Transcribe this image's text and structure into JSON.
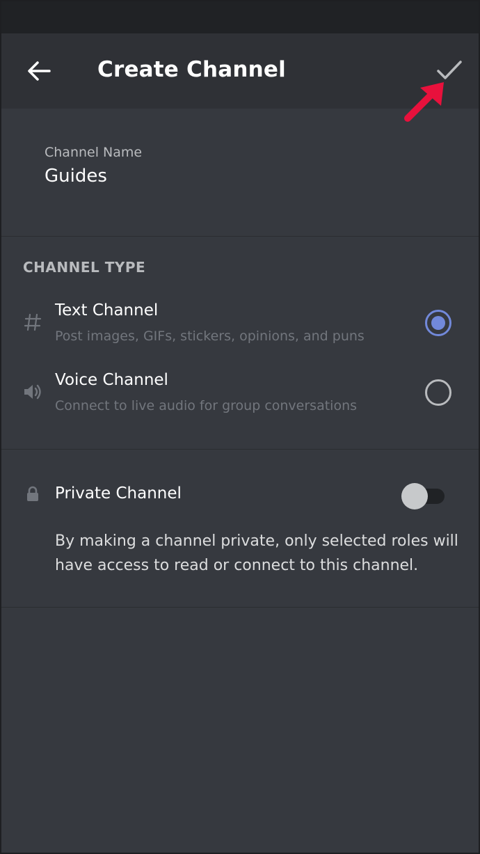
{
  "header": {
    "title": "Create Channel",
    "back_icon": "arrow-left-icon",
    "confirm_icon": "checkmark-icon"
  },
  "channel_name": {
    "label": "Channel Name",
    "value": "Guides"
  },
  "channel_type": {
    "heading": "CHANNEL TYPE",
    "options": [
      {
        "icon": "hashtag-icon",
        "title": "Text Channel",
        "description": "Post images, GIFs, stickers, opinions, and puns",
        "selected": true
      },
      {
        "icon": "speaker-icon",
        "title": "Voice Channel",
        "description": "Connect to live audio for group conversations",
        "selected": false
      }
    ]
  },
  "private": {
    "label": "Private Channel",
    "enabled": false,
    "description": "By making a channel private, only selected roles will have access to read or connect to this channel."
  },
  "colors": {
    "background": "#36393f",
    "header": "#2f3136",
    "accent": "#7289da",
    "annotation_arrow": "#e8113c"
  }
}
